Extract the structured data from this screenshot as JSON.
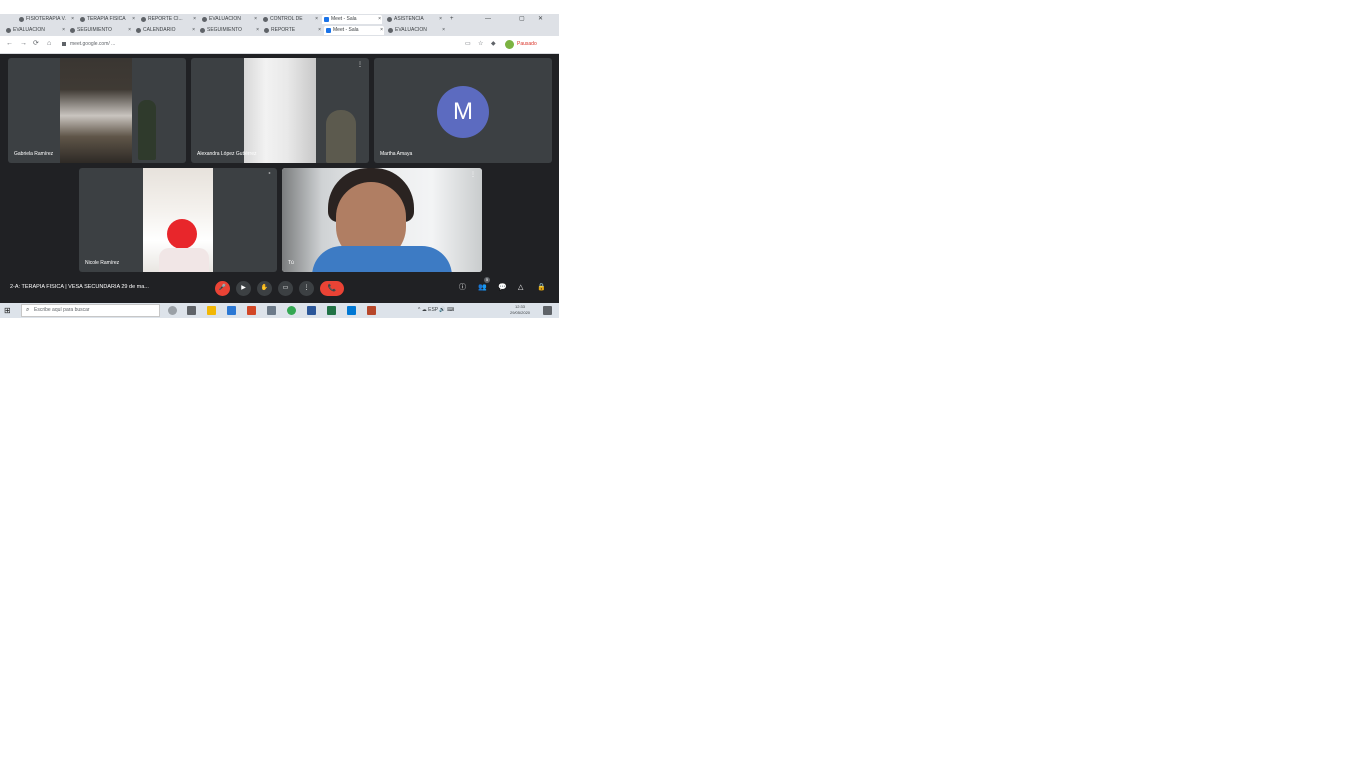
{
  "browser": {
    "tabs_row1": [
      {
        "label": "FISIOTERAPIA V."
      },
      {
        "label": "TERAPIA FISICA"
      },
      {
        "label": "REPORTE CI..."
      },
      {
        "label": "EVALUACION"
      },
      {
        "label": "CONTROL DE"
      },
      {
        "label": "Meet - Sala",
        "active": true
      },
      {
        "label": "ASISTENCIA"
      }
    ],
    "tabs_row2": [
      {
        "label": "EVALUACION"
      },
      {
        "label": "SEGUIMIENTO"
      },
      {
        "label": "CALENDARIO"
      },
      {
        "label": "SEGUIMIENTO"
      },
      {
        "label": "REPORTE"
      },
      {
        "label": "Meet - Sala",
        "active": true
      },
      {
        "label": "EVALUACION"
      }
    ],
    "new_tab_label": "+",
    "window_controls": {
      "minimize": "—",
      "maximize": "▢",
      "close": "✕"
    },
    "url": "meet.google.com/ ...",
    "paused_label": "Pausado",
    "nav": {
      "back": "←",
      "forward": "→",
      "reload": "⟳",
      "home": "⌂"
    }
  },
  "meet": {
    "participants": [
      {
        "name": "Gabriela Ramírez"
      },
      {
        "name": "Alexandra López Gutiérrez"
      },
      {
        "name": "Martha Amaya",
        "initial": "M",
        "avatar_color": "#5c6bc0"
      },
      {
        "name": "Nicole Ramírez"
      },
      {
        "name": "Tú"
      }
    ],
    "meeting_title": "2-A: TERAPIA FISICA | VESA SECUNDARIA 29 de ma...",
    "controls": {
      "mic": "🎤",
      "camera": "▶",
      "hand": "✋",
      "present": "▭",
      "more": "⋮",
      "hangup": "📞"
    },
    "right_controls": {
      "info": "ⓘ",
      "people": "👥",
      "chat": "💬",
      "activities": "△",
      "lock": "🔒"
    },
    "people_count": "5",
    "accent_red": "#ea4335"
  },
  "taskbar": {
    "search_placeholder": "Escribe aquí para buscar",
    "start_icon": "⊞",
    "tray": "^  ☁ ESP  🔊  ⌨",
    "clock_time": "12:33",
    "clock_date": "29/05/2020"
  }
}
